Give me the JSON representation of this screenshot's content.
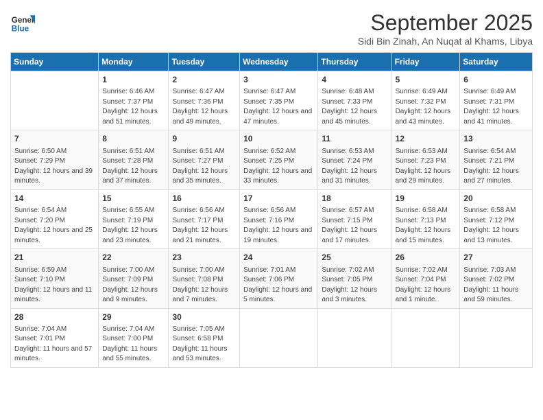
{
  "header": {
    "logo_line1": "General",
    "logo_line2": "Blue",
    "month": "September 2025",
    "location": "Sidi Bin Zinah, An Nuqat al Khams, Libya"
  },
  "days_of_week": [
    "Sunday",
    "Monday",
    "Tuesday",
    "Wednesday",
    "Thursday",
    "Friday",
    "Saturday"
  ],
  "weeks": [
    [
      {
        "day": "",
        "sunrise": "",
        "sunset": "",
        "daylight": ""
      },
      {
        "day": "1",
        "sunrise": "Sunrise: 6:46 AM",
        "sunset": "Sunset: 7:37 PM",
        "daylight": "Daylight: 12 hours and 51 minutes."
      },
      {
        "day": "2",
        "sunrise": "Sunrise: 6:47 AM",
        "sunset": "Sunset: 7:36 PM",
        "daylight": "Daylight: 12 hours and 49 minutes."
      },
      {
        "day": "3",
        "sunrise": "Sunrise: 6:47 AM",
        "sunset": "Sunset: 7:35 PM",
        "daylight": "Daylight: 12 hours and 47 minutes."
      },
      {
        "day": "4",
        "sunrise": "Sunrise: 6:48 AM",
        "sunset": "Sunset: 7:33 PM",
        "daylight": "Daylight: 12 hours and 45 minutes."
      },
      {
        "day": "5",
        "sunrise": "Sunrise: 6:49 AM",
        "sunset": "Sunset: 7:32 PM",
        "daylight": "Daylight: 12 hours and 43 minutes."
      },
      {
        "day": "6",
        "sunrise": "Sunrise: 6:49 AM",
        "sunset": "Sunset: 7:31 PM",
        "daylight": "Daylight: 12 hours and 41 minutes."
      }
    ],
    [
      {
        "day": "7",
        "sunrise": "Sunrise: 6:50 AM",
        "sunset": "Sunset: 7:29 PM",
        "daylight": "Daylight: 12 hours and 39 minutes."
      },
      {
        "day": "8",
        "sunrise": "Sunrise: 6:51 AM",
        "sunset": "Sunset: 7:28 PM",
        "daylight": "Daylight: 12 hours and 37 minutes."
      },
      {
        "day": "9",
        "sunrise": "Sunrise: 6:51 AM",
        "sunset": "Sunset: 7:27 PM",
        "daylight": "Daylight: 12 hours and 35 minutes."
      },
      {
        "day": "10",
        "sunrise": "Sunrise: 6:52 AM",
        "sunset": "Sunset: 7:25 PM",
        "daylight": "Daylight: 12 hours and 33 minutes."
      },
      {
        "day": "11",
        "sunrise": "Sunrise: 6:53 AM",
        "sunset": "Sunset: 7:24 PM",
        "daylight": "Daylight: 12 hours and 31 minutes."
      },
      {
        "day": "12",
        "sunrise": "Sunrise: 6:53 AM",
        "sunset": "Sunset: 7:23 PM",
        "daylight": "Daylight: 12 hours and 29 minutes."
      },
      {
        "day": "13",
        "sunrise": "Sunrise: 6:54 AM",
        "sunset": "Sunset: 7:21 PM",
        "daylight": "Daylight: 12 hours and 27 minutes."
      }
    ],
    [
      {
        "day": "14",
        "sunrise": "Sunrise: 6:54 AM",
        "sunset": "Sunset: 7:20 PM",
        "daylight": "Daylight: 12 hours and 25 minutes."
      },
      {
        "day": "15",
        "sunrise": "Sunrise: 6:55 AM",
        "sunset": "Sunset: 7:19 PM",
        "daylight": "Daylight: 12 hours and 23 minutes."
      },
      {
        "day": "16",
        "sunrise": "Sunrise: 6:56 AM",
        "sunset": "Sunset: 7:17 PM",
        "daylight": "Daylight: 12 hours and 21 minutes."
      },
      {
        "day": "17",
        "sunrise": "Sunrise: 6:56 AM",
        "sunset": "Sunset: 7:16 PM",
        "daylight": "Daylight: 12 hours and 19 minutes."
      },
      {
        "day": "18",
        "sunrise": "Sunrise: 6:57 AM",
        "sunset": "Sunset: 7:15 PM",
        "daylight": "Daylight: 12 hours and 17 minutes."
      },
      {
        "day": "19",
        "sunrise": "Sunrise: 6:58 AM",
        "sunset": "Sunset: 7:13 PM",
        "daylight": "Daylight: 12 hours and 15 minutes."
      },
      {
        "day": "20",
        "sunrise": "Sunrise: 6:58 AM",
        "sunset": "Sunset: 7:12 PM",
        "daylight": "Daylight: 12 hours and 13 minutes."
      }
    ],
    [
      {
        "day": "21",
        "sunrise": "Sunrise: 6:59 AM",
        "sunset": "Sunset: 7:10 PM",
        "daylight": "Daylight: 12 hours and 11 minutes."
      },
      {
        "day": "22",
        "sunrise": "Sunrise: 7:00 AM",
        "sunset": "Sunset: 7:09 PM",
        "daylight": "Daylight: 12 hours and 9 minutes."
      },
      {
        "day": "23",
        "sunrise": "Sunrise: 7:00 AM",
        "sunset": "Sunset: 7:08 PM",
        "daylight": "Daylight: 12 hours and 7 minutes."
      },
      {
        "day": "24",
        "sunrise": "Sunrise: 7:01 AM",
        "sunset": "Sunset: 7:06 PM",
        "daylight": "Daylight: 12 hours and 5 minutes."
      },
      {
        "day": "25",
        "sunrise": "Sunrise: 7:02 AM",
        "sunset": "Sunset: 7:05 PM",
        "daylight": "Daylight: 12 hours and 3 minutes."
      },
      {
        "day": "26",
        "sunrise": "Sunrise: 7:02 AM",
        "sunset": "Sunset: 7:04 PM",
        "daylight": "Daylight: 12 hours and 1 minute."
      },
      {
        "day": "27",
        "sunrise": "Sunrise: 7:03 AM",
        "sunset": "Sunset: 7:02 PM",
        "daylight": "Daylight: 11 hours and 59 minutes."
      }
    ],
    [
      {
        "day": "28",
        "sunrise": "Sunrise: 7:04 AM",
        "sunset": "Sunset: 7:01 PM",
        "daylight": "Daylight: 11 hours and 57 minutes."
      },
      {
        "day": "29",
        "sunrise": "Sunrise: 7:04 AM",
        "sunset": "Sunset: 7:00 PM",
        "daylight": "Daylight: 11 hours and 55 minutes."
      },
      {
        "day": "30",
        "sunrise": "Sunrise: 7:05 AM",
        "sunset": "Sunset: 6:58 PM",
        "daylight": "Daylight: 11 hours and 53 minutes."
      },
      {
        "day": "",
        "sunrise": "",
        "sunset": "",
        "daylight": ""
      },
      {
        "day": "",
        "sunrise": "",
        "sunset": "",
        "daylight": ""
      },
      {
        "day": "",
        "sunrise": "",
        "sunset": "",
        "daylight": ""
      },
      {
        "day": "",
        "sunrise": "",
        "sunset": "",
        "daylight": ""
      }
    ]
  ]
}
